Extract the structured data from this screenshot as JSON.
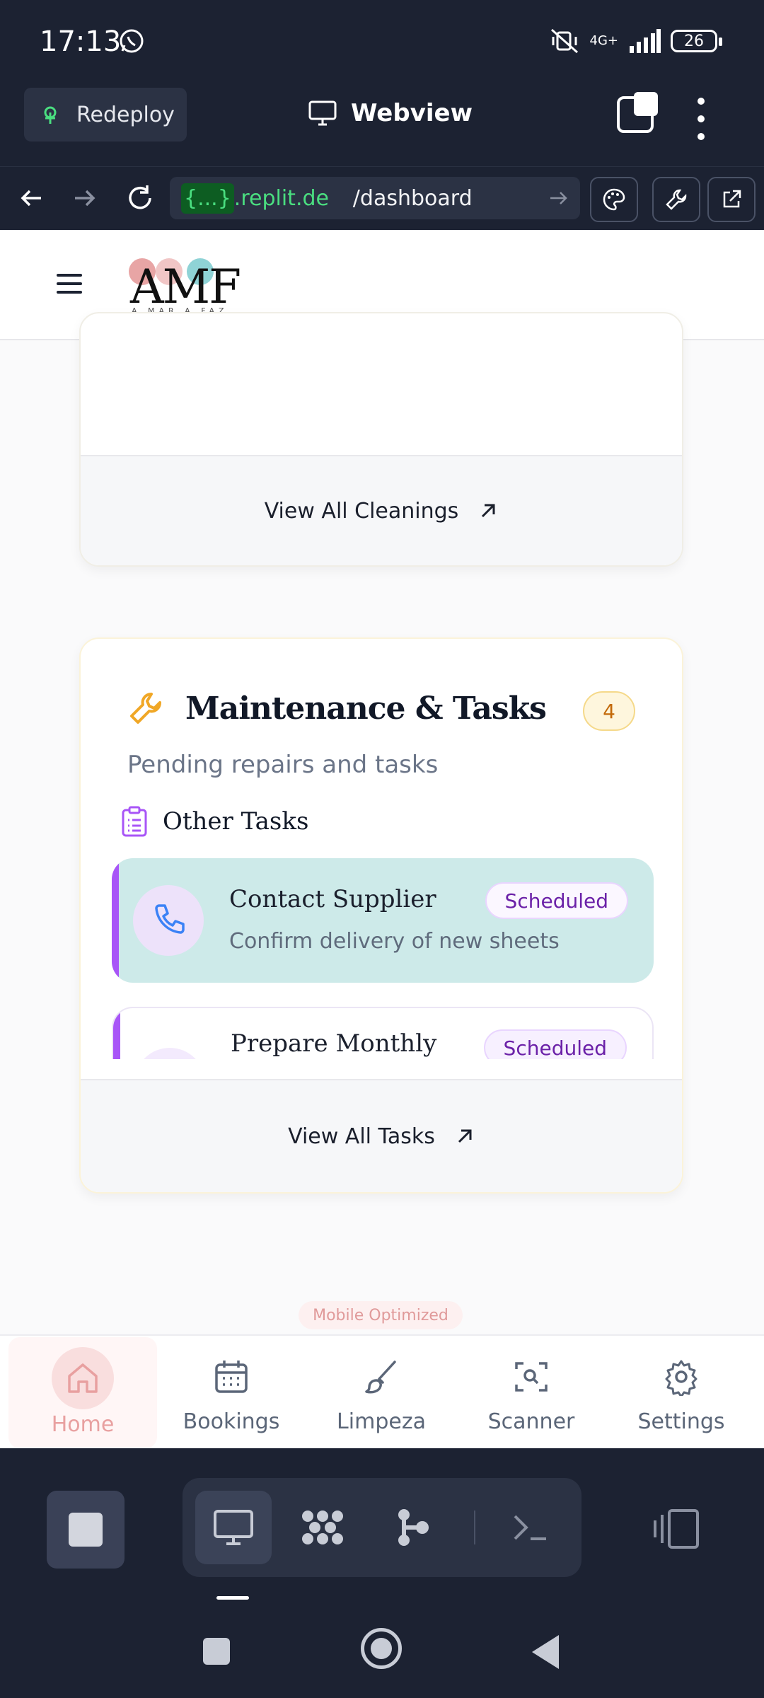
{
  "status_bar": {
    "time": "17:13",
    "network": "4G+",
    "battery": "26"
  },
  "replit_header": {
    "redeploy_label": "Redeploy",
    "webview_title": "Webview"
  },
  "url_bar": {
    "host_code": "{...}",
    "host": ".replit.de",
    "path": "/dashboard"
  },
  "cleanings_card": {
    "footer_label": "View All Cleanings"
  },
  "maintenance_card": {
    "title": "Maintenance & Tasks",
    "count": "4",
    "subtitle": "Pending repairs and tasks",
    "section_title": "Other Tasks",
    "tasks": [
      {
        "title": "Contact Supplier",
        "description": "Confirm delivery of new sheets",
        "status": "Scheduled"
      },
      {
        "title": "Prepare Monthly",
        "status": "Scheduled"
      }
    ],
    "footer_label": "View All Tasks"
  },
  "mobile_badge": "Mobile Optimized",
  "bottom_nav": {
    "items": [
      {
        "label": "Home",
        "icon": "home-icon",
        "active": true
      },
      {
        "label": "Bookings",
        "icon": "calendar-icon"
      },
      {
        "label": "Limpeza",
        "icon": "brush-icon"
      },
      {
        "label": "Scanner",
        "icon": "scan-icon"
      },
      {
        "label": "Settings",
        "icon": "gear-icon"
      }
    ]
  },
  "colors": {
    "chrome_bg": "#1c2232",
    "accent_purple": "#a855f7",
    "task_highlight": "#cdeae9",
    "home_active": "#e8a0a0",
    "badge_amber": "#c36a0a"
  }
}
